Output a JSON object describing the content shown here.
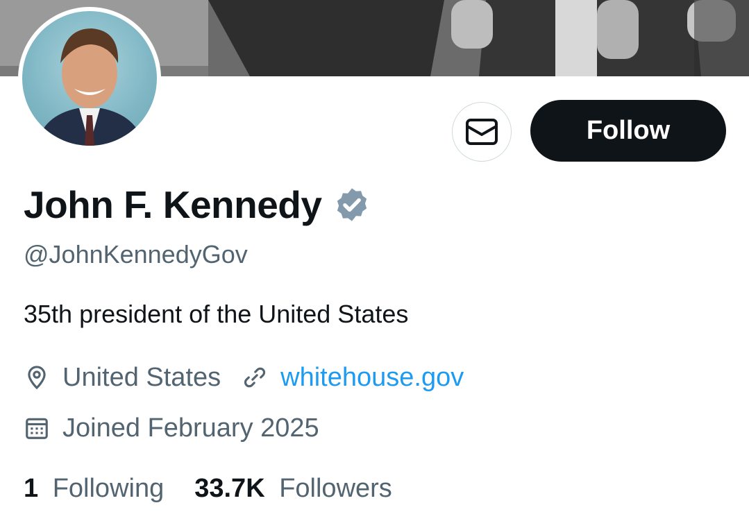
{
  "profile": {
    "display_name": "John F. Kennedy",
    "handle": "@JohnKennedyGov",
    "bio": "35th president of the United States",
    "location": "United States",
    "website": "whitehouse.gov",
    "joined": "Joined February 2025",
    "following_count": "1",
    "following_label": "Following",
    "followers_count": "33.7K",
    "followers_label": "Followers"
  },
  "actions": {
    "follow_label": "Follow",
    "message_icon": "envelope-icon"
  },
  "icons": {
    "verified": "verified-badge-icon",
    "location": "location-pin-icon",
    "link": "link-icon",
    "calendar": "calendar-icon"
  },
  "colors": {
    "primary_text": "#0f1419",
    "secondary_text": "#536471",
    "link": "#1d9bf0",
    "follow_bg": "#0f1419",
    "verified_badge": "#829aab"
  }
}
